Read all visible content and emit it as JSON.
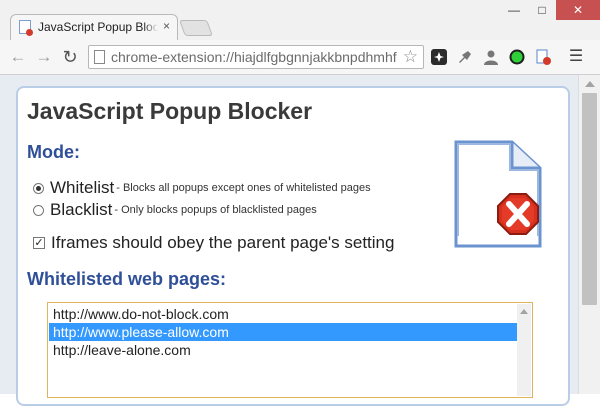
{
  "browser": {
    "tab_title": "JavaScript Popup Blocker",
    "tab_close": "×",
    "url": "chrome-extension://hiajdlfgbgnnjakkbnpdhmhf"
  },
  "page": {
    "title": "JavaScript Popup Blocker",
    "mode_heading": "Mode:",
    "modes": [
      {
        "label": "Whitelist",
        "desc": "- Blocks all popups except ones of whitelisted pages",
        "selected": true
      },
      {
        "label": "Blacklist",
        "desc": "- Only blocks popups of blacklisted pages",
        "selected": false
      }
    ],
    "iframe_option": {
      "label": "Iframes should obey the parent page's setting",
      "checked": true
    },
    "whitelist_heading": "Whitelisted web pages:",
    "whitelist": [
      {
        "url": "http://www.do-not-block.com",
        "selected": false
      },
      {
        "url": "http://www.please-allow.com",
        "selected": true
      },
      {
        "url": "http://leave-alone.com",
        "selected": false
      }
    ]
  },
  "colors": {
    "heading_blue": "#2f4f98",
    "selection": "#3399ff",
    "close_red": "#c75050"
  }
}
